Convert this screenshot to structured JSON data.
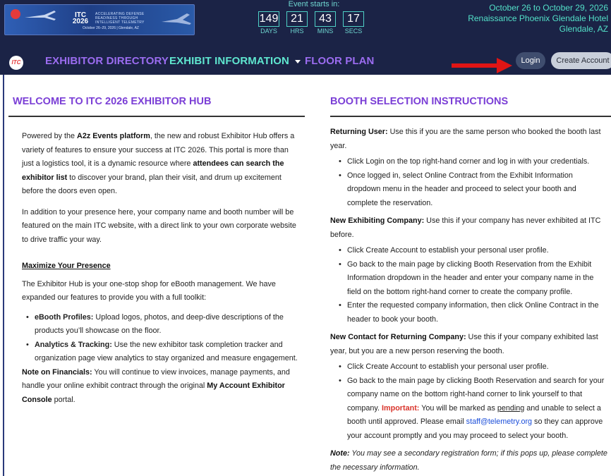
{
  "banner": {
    "title": "ITC 2026",
    "tagline": "ACCELERATING DEFENSE READINESS THROUGH INTELLIGENT TELEMETRY",
    "dates": "October 26–29, 2026 | Glendale, AZ"
  },
  "countdown": {
    "label": "Event starts in:",
    "units": [
      {
        "value": "149",
        "unit": "DAYS"
      },
      {
        "value": "21",
        "unit": "HRS"
      },
      {
        "value": "43",
        "unit": "MINS"
      },
      {
        "value": "17",
        "unit": "SECS"
      }
    ]
  },
  "event_info": {
    "dates": "October 26 to October 29, 2026",
    "venue": "Renaissance Phoenix Glendale Hotel",
    "city": "Glendale, AZ"
  },
  "nav": {
    "logo": "ITC",
    "directory": "EXHIBITOR DIRECTORY",
    "info": "EXHIBIT INFORMATION",
    "floor": "FLOOR PLAN",
    "login": "Login",
    "create": "Create Account"
  },
  "left": {
    "title": "WELCOME TO ITC 2026 EXHIBITOR HUB",
    "p1_a": "Powered by the ",
    "p1_b": "A2z Events platform",
    "p1_c": ", the new and robust Exhibitor Hub offers a variety of features to ensure your success at ITC 2026. This portal is more than just a logistics tool, it is a dynamic resource where ",
    "p1_d": "attendees can search the exhibitor list",
    "p1_e": " to discover your brand, plan their visit, and drum up excitement before the doors even open.",
    "p2": "In addition to your presence here, your company name and booth number will be featured on the main ITC website, with a direct link to your own corporate website to drive traffic your way.",
    "heading": "Maximize Your Presence",
    "p3": "The Exhibitor Hub is your one-stop shop for eBooth management. We have expanded our features to provide you with a full toolkit:",
    "b1_title": "eBooth Profiles:",
    "b1_text": " Upload logos, photos, and deep-dive descriptions of the products you’ll showcase on the floor.",
    "b2_title": "Analytics & Tracking:",
    "b2_text": " Use the new exhibitor task completion tracker and organization page view analytics to stay organized and measure engagement.",
    "fin_title": "Note on Financials:",
    "fin_text": " You will continue to view invoices, manage payments, and handle your online exhibit contract through the original ",
    "fin_link": "My Account Exhibitor Console",
    "fin_end": " portal."
  },
  "right": {
    "title": "BOOTH SELECTION INSTRUCTIONS",
    "r1_title": "Returning User:",
    "r1_text": " Use this if you are the same person who booked the booth last year.",
    "r1_b1": "Click Login on the top right-hand corner and log in with your credentials.",
    "r1_b2": "Once logged in, select Online Contract from the Exhibit Information dropdown menu in the header and proceed to select your booth and complete the reservation.",
    "r2_title": "New Exhibiting Company:",
    "r2_text": " Use this if your company has never exhibited at ITC before.",
    "r2_b1": "Click Create Account to establish your personal user profile.",
    "r2_b2": "Go back to the main page by clicking Booth Reservation from the Exhibit Information dropdown in the header and enter your company name in the field on the bottom right-hand corner to create the company profile.",
    "r2_b3": "Enter the requested company information, then click Online Contract in the header to book your booth.",
    "r3_title": "New Contact for Returning Company:",
    "r3_text": " Use this if your company exhibited last year, but you are a new person reserving the booth.",
    "r3_b1": "Click Create Account to establish your personal user profile.",
    "r3_b2_a": "Go back to the main page by clicking Booth Reservation and search for your company name on the bottom right-hand corner to link yourself to that company. ",
    "r3_b2_imp": "Important:",
    "r3_b2_b": " You will be marked as ",
    "r3_b2_pending": "pending",
    "r3_b2_c": " and unable to select a booth until approved. Please email ",
    "r3_b2_email": "staff@telemetry.org",
    "r3_b2_d": " so they can approve your account promptly and you may proceed to select your booth.",
    "note_title": "Note:",
    "note_text": " You may see a secondary registration form; if this pops up, please complete the necessary information."
  }
}
